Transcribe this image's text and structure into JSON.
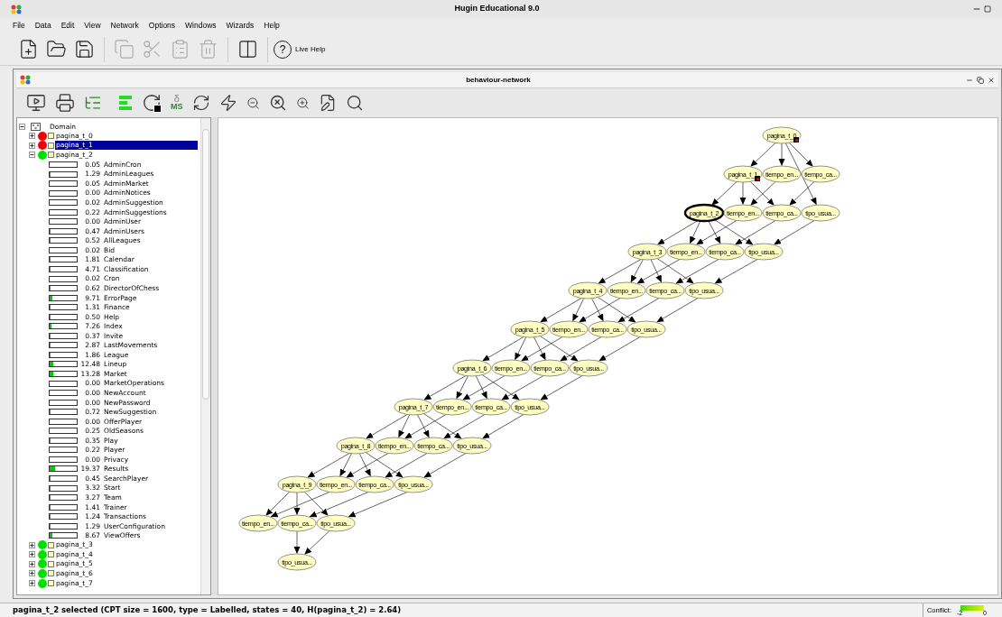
{
  "app_title_bar": {
    "title": "Hugin Educational 9.0"
  },
  "menu": [
    "File",
    "Data",
    "Edit",
    "View",
    "Network",
    "Options",
    "Windows",
    "Wizards",
    "Help"
  ],
  "toolbar": {
    "buttons": [
      {
        "kind": "new",
        "disabled": false
      },
      {
        "kind": "open",
        "disabled": false
      },
      {
        "kind": "save",
        "disabled": false
      },
      {
        "kind": "copy",
        "disabled": true
      },
      {
        "kind": "cut",
        "disabled": true
      },
      {
        "kind": "paste",
        "disabled": true
      },
      {
        "kind": "delete",
        "disabled": true
      },
      {
        "kind": "split",
        "disabled": false
      }
    ],
    "help": {
      "symbol": "?",
      "label": "Live Help"
    }
  },
  "document": {
    "title": "behaviour-network",
    "toolbar": [
      {
        "kind": "view"
      },
      {
        "kind": "print"
      },
      {
        "kind": "list"
      },
      {
        "kind": "bars"
      },
      {
        "kind": "propagate"
      },
      {
        "kind": "ms",
        "symbol": "δ",
        "caption": "MS"
      },
      {
        "kind": "refresh"
      },
      {
        "kind": "flash"
      },
      {
        "kind": "zoom-out"
      },
      {
        "kind": "zoom-fit"
      },
      {
        "kind": "zoom-in"
      },
      {
        "kind": "edit-tree"
      },
      {
        "kind": "search"
      }
    ],
    "tree": {
      "root": "Domain",
      "nodes": [
        {
          "label": "pagina_t_0",
          "evidence": true,
          "expanded": false,
          "selected": false
        },
        {
          "label": "pagina_t_1",
          "evidence": true,
          "expanded": false,
          "selected": true
        },
        {
          "label": "pagina_t_2",
          "evidence": false,
          "expanded": true,
          "selected": false,
          "states": [
            {
              "value": "0.05",
              "name": "AdminCron",
              "level": 0.0005
            },
            {
              "value": "1.29",
              "name": "AdminLeagues",
              "level": 0.0129
            },
            {
              "value": "0.05",
              "name": "AdminMarket",
              "level": 0.0005
            },
            {
              "value": "0.00",
              "name": "AdminNotices",
              "level": 0
            },
            {
              "value": "0.02",
              "name": "AdminSuggestion",
              "level": 0.0002
            },
            {
              "value": "0.22",
              "name": "AdminSuggestions",
              "level": 0.0022
            },
            {
              "value": "0.00",
              "name": "AdminUser",
              "level": 0
            },
            {
              "value": "0.47",
              "name": "AdminUsers",
              "level": 0.0047
            },
            {
              "value": "0.52",
              "name": "AllLeagues",
              "level": 0.0052
            },
            {
              "value": "0.02",
              "name": "Bid",
              "level": 0.0002
            },
            {
              "value": "1.81",
              "name": "Calendar",
              "level": 0.0181
            },
            {
              "value": "4.71",
              "name": "Classification",
              "level": 0.0471
            },
            {
              "value": "0.02",
              "name": "Cron",
              "level": 0.0002
            },
            {
              "value": "0.62",
              "name": "DirectorOfChess",
              "level": 0.0062
            },
            {
              "value": "9.71",
              "name": "ErrorPage",
              "level": 0.0971
            },
            {
              "value": "1.31",
              "name": "Finance",
              "level": 0.0131
            },
            {
              "value": "0.50",
              "name": "Help",
              "level": 0.005
            },
            {
              "value": "7.26",
              "name": "Index",
              "level": 0.0726
            },
            {
              "value": "0.37",
              "name": "Invite",
              "level": 0.0037
            },
            {
              "value": "2.87",
              "name": "LastMovements",
              "level": 0.0287
            },
            {
              "value": "1.86",
              "name": "League",
              "level": 0.0186
            },
            {
              "value": "12.48",
              "name": "Lineup",
              "level": 0.1248
            },
            {
              "value": "13.28",
              "name": "Market",
              "level": 0.1328
            },
            {
              "value": "0.00",
              "name": "MarketOperations",
              "level": 0
            },
            {
              "value": "0.00",
              "name": "NewAccount",
              "level": 0
            },
            {
              "value": "0.00",
              "name": "NewPassword",
              "level": 0
            },
            {
              "value": "0.72",
              "name": "NewSuggestion",
              "level": 0.0072
            },
            {
              "value": "0.00",
              "name": "OfferPlayer",
              "level": 0
            },
            {
              "value": "0.25",
              "name": "OldSeasons",
              "level": 0.0025
            },
            {
              "value": "0.35",
              "name": "Play",
              "level": 0.0035
            },
            {
              "value": "0.22",
              "name": "Player",
              "level": 0.0022
            },
            {
              "value": "0.00",
              "name": "Privacy",
              "level": 0
            },
            {
              "value": "19.37",
              "name": "Results",
              "level": 0.1937
            },
            {
              "value": "0.45",
              "name": "SearchPlayer",
              "level": 0.0045
            },
            {
              "value": "3.32",
              "name": "Start",
              "level": 0.0332
            },
            {
              "value": "3.27",
              "name": "Team",
              "level": 0.0327
            },
            {
              "value": "1.41",
              "name": "Trainer",
              "level": 0.0141
            },
            {
              "value": "1.24",
              "name": "Transactions",
              "level": 0.0124
            },
            {
              "value": "1.29",
              "name": "UserConfiguration",
              "level": 0.0129
            },
            {
              "value": "8.67",
              "name": "ViewOffers",
              "level": 0.0867
            }
          ]
        },
        {
          "label": "pagina_t_3",
          "evidence": false,
          "expanded": false,
          "selected": false
        },
        {
          "label": "pagina_t_4",
          "evidence": false,
          "expanded": false,
          "selected": false
        },
        {
          "label": "pagina_t_5",
          "evidence": false,
          "expanded": false,
          "selected": false
        },
        {
          "label": "pagina_t_6",
          "evidence": false,
          "expanded": false,
          "selected": false
        },
        {
          "label": "pagina_t_7",
          "evidence": false,
          "expanded": false,
          "selected": false
        }
      ]
    },
    "network": {
      "rows": [
        [
          {
            "kind": "pagina",
            "label": "pagina_t_0",
            "selected": false,
            "evidence": true
          }
        ],
        [
          {
            "kind": "pagina",
            "label": "pagina_t_1",
            "selected": false,
            "evidence": true
          },
          {
            "kind": "tiempo_en",
            "label": "tiempo_en..."
          },
          {
            "kind": "tiempo_ca",
            "label": "tiempo_ca..."
          }
        ],
        [
          {
            "kind": "pagina",
            "label": "pagina_t_2",
            "selected": true,
            "evidence": false
          },
          {
            "kind": "tiempo_en",
            "label": "tiempo_en..."
          },
          {
            "kind": "tiempo_ca",
            "label": "tiempo_ca..."
          },
          {
            "kind": "tipo_usua",
            "label": "tipo_usua..."
          }
        ],
        [
          {
            "kind": "pagina",
            "label": "pagina_t_3",
            "selected": false,
            "evidence": false
          },
          {
            "kind": "tiempo_en",
            "label": "tiempo_en..."
          },
          {
            "kind": "tiempo_ca",
            "label": "tiempo_ca..."
          },
          {
            "kind": "tipo_usua",
            "label": "tipo_usua..."
          }
        ],
        [
          {
            "kind": "pagina",
            "label": "pagina_t_4",
            "selected": false,
            "evidence": false
          },
          {
            "kind": "tiempo_en",
            "label": "tiempo_en..."
          },
          {
            "kind": "tiempo_ca",
            "label": "tiempo_ca..."
          },
          {
            "kind": "tipo_usua",
            "label": "tipo_usua..."
          }
        ],
        [
          {
            "kind": "pagina",
            "label": "pagina_t_5",
            "selected": false,
            "evidence": false
          },
          {
            "kind": "tiempo_en",
            "label": "tiempo_en..."
          },
          {
            "kind": "tiempo_ca",
            "label": "tiempo_ca..."
          },
          {
            "kind": "tipo_usua",
            "label": "tipo_usua..."
          }
        ],
        [
          {
            "kind": "pagina",
            "label": "pagina_t_6",
            "selected": false,
            "evidence": false
          },
          {
            "kind": "tiempo_en",
            "label": "tiempo_en..."
          },
          {
            "kind": "tiempo_ca",
            "label": "tiempo_ca..."
          },
          {
            "kind": "tipo_usua",
            "label": "tipo_usua..."
          }
        ],
        [
          {
            "kind": "pagina",
            "label": "pagina_t_7",
            "selected": false,
            "evidence": false
          },
          {
            "kind": "tiempo_en",
            "label": "tiempo_en..."
          },
          {
            "kind": "tiempo_ca",
            "label": "tiempo_ca..."
          },
          {
            "kind": "tipo_usua",
            "label": "tipo_usua..."
          }
        ],
        [
          {
            "kind": "pagina",
            "label": "pagina_t_8",
            "selected": false,
            "evidence": false
          },
          {
            "kind": "tiempo_en",
            "label": "tiempo_en..."
          },
          {
            "kind": "tiempo_ca",
            "label": "tiempo_ca..."
          },
          {
            "kind": "tipo_usua",
            "label": "tipo_usua..."
          }
        ],
        [
          {
            "kind": "pagina",
            "label": "pagina_t_9",
            "selected": false,
            "evidence": false
          },
          {
            "kind": "tiempo_en",
            "label": "tiempo_en..."
          },
          {
            "kind": "tiempo_ca",
            "label": "tiempo_ca..."
          },
          {
            "kind": "tipo_usua",
            "label": "tipo_usua..."
          }
        ],
        [
          {
            "kind": "tiempo_en",
            "label": "tiempo_en..."
          },
          {
            "kind": "tiempo_ca",
            "label": "tiempo_ca..."
          },
          {
            "kind": "tipo_usua",
            "label": "tipo_usua..."
          }
        ],
        [
          {
            "kind": "tipo_usua",
            "label": "tipo_usua..."
          }
        ]
      ]
    }
  },
  "status_bar": {
    "message": "pagina_t_2 selected (CPT size = 1600, type = Labelled, states = 40, H(pagina_t_2) = 2.64)",
    "conflict_label": "Conflict:",
    "conflict_ticks": [
      "-2",
      "0"
    ]
  }
}
